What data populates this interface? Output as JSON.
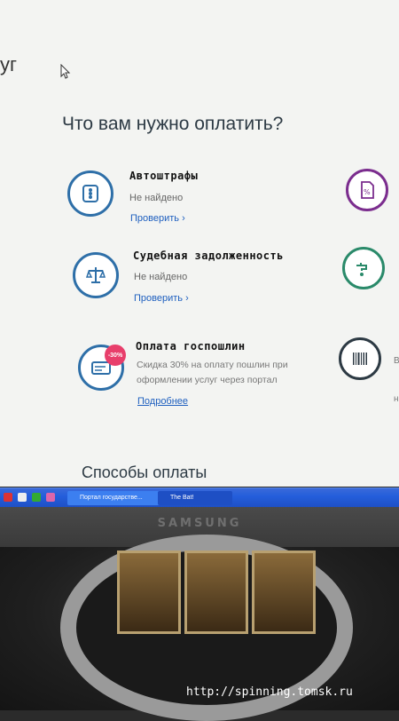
{
  "header": {
    "fragment": "уг"
  },
  "page_title": "Что вам нужно оплатить?",
  "services": [
    {
      "title": "Автоштрафы",
      "status": "Не найдено",
      "link": "Проверить ›"
    },
    {
      "title": "Судебная задолженность",
      "status": "Не найдено",
      "link": "Проверить ›"
    },
    {
      "title": "Оплата госпошлин",
      "description": "Скидка 30% на оплату пошлин при оформлении услуг через портал",
      "badge": "-30%",
      "link": "Подробнее"
    }
  ],
  "right_column_fragments": {
    "line1": "В",
    "line2": "н"
  },
  "section_title": "Способы оплаты",
  "taskbar": {
    "tasks": [
      "Портал государстве...",
      "The Bat!"
    ]
  },
  "monitor_brand": "SAMSUNG",
  "watermark": "http://spinning.tomsk.ru",
  "colors": {
    "accent_blue": "#2e6fa8",
    "link_blue": "#1e5fbf",
    "badge_pink": "#e83e6b",
    "purple": "#7b2d8e",
    "teal": "#2a8a6a"
  }
}
